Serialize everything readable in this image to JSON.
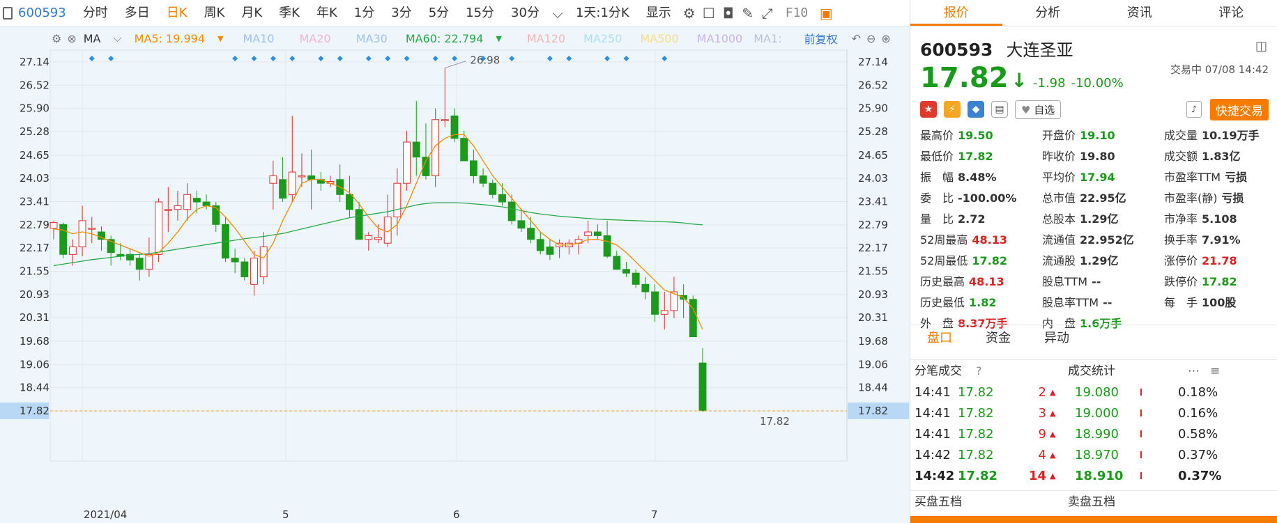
{
  "toolbar": {
    "code": "600593",
    "tabs": [
      "分时",
      "多日",
      "日K",
      "周K",
      "月K",
      "季K",
      "年K",
      "1分",
      "3分",
      "5分",
      "15分",
      "30分"
    ],
    "period": "1天:1分K",
    "display": "显示",
    "f10": "F10"
  },
  "ma_row": {
    "ma": "MA",
    "ma5": "MA5: 19.994",
    "ma10": "MA10",
    "ma20": "MA20",
    "ma30": "MA30",
    "ma60": "MA60: 22.794",
    "ma120": "MA120",
    "ma250": "MA250",
    "ma500": "MA500",
    "ma1000": "MA1000",
    "ma1": "MA1:",
    "adjust": "前复权",
    "colors": {
      "ma5": "#f08c00",
      "ma60": "#2aa84a",
      "faded_ma10": "#9ec2ea",
      "faded_ma20": "#f2b3cf",
      "faded_ma120": "#f5b5b5",
      "faded_ma250": "#aee0f0",
      "faded_ma500": "#f6dc8c",
      "faded_ma1000": "#c9b3ea",
      "faded_ma1": "#b9c5d2",
      "ma_label": "#333333",
      "adjust": "#3478d1"
    }
  },
  "chart_data": {
    "type": "candlestick",
    "y_ticks": [
      "27.14",
      "26.52",
      "25.90",
      "25.28",
      "24.65",
      "24.03",
      "23.41",
      "22.79",
      "22.17",
      "21.55",
      "20.93",
      "20.31",
      "19.68",
      "19.06",
      "18.44",
      "17.82"
    ],
    "ylim": [
      17.82,
      27.14
    ],
    "x_labels": [
      "2021/04",
      "5",
      "6",
      "7"
    ],
    "high_annotation": "26.98",
    "low_annotation": "17.82",
    "current_price_label": "17.82",
    "candles": [
      {
        "o": 22.7,
        "h": 22.9,
        "l": 22.4,
        "c": 22.85
      },
      {
        "o": 22.8,
        "h": 22.85,
        "l": 21.9,
        "c": 22.0
      },
      {
        "o": 22.0,
        "h": 22.4,
        "l": 21.7,
        "c": 22.2
      },
      {
        "o": 22.2,
        "h": 23.3,
        "l": 21.95,
        "c": 22.9
      },
      {
        "o": 22.7,
        "h": 23.0,
        "l": 22.3,
        "c": 22.7
      },
      {
        "o": 22.6,
        "h": 22.75,
        "l": 22.1,
        "c": 22.4
      },
      {
        "o": 22.4,
        "h": 22.5,
        "l": 21.7,
        "c": 22.05
      },
      {
        "o": 22.0,
        "h": 22.3,
        "l": 21.85,
        "c": 21.95
      },
      {
        "o": 22.0,
        "h": 22.15,
        "l": 21.7,
        "c": 21.85
      },
      {
        "o": 21.9,
        "h": 22.0,
        "l": 21.3,
        "c": 21.6
      },
      {
        "o": 21.6,
        "h": 22.45,
        "l": 21.4,
        "c": 22.0
      },
      {
        "o": 22.0,
        "h": 23.5,
        "l": 21.8,
        "c": 23.4
      },
      {
        "o": 23.2,
        "h": 23.8,
        "l": 22.6,
        "c": 23.2
      },
      {
        "o": 23.2,
        "h": 23.7,
        "l": 22.9,
        "c": 23.3
      },
      {
        "o": 23.2,
        "h": 23.9,
        "l": 22.9,
        "c": 23.6
      },
      {
        "o": 23.5,
        "h": 23.7,
        "l": 23.1,
        "c": 23.4
      },
      {
        "o": 23.4,
        "h": 23.6,
        "l": 23.2,
        "c": 23.3
      },
      {
        "o": 23.3,
        "h": 23.4,
        "l": 22.6,
        "c": 22.8
      },
      {
        "o": 22.8,
        "h": 23.0,
        "l": 21.8,
        "c": 21.9
      },
      {
        "o": 21.9,
        "h": 22.15,
        "l": 21.5,
        "c": 21.8
      },
      {
        "o": 21.8,
        "h": 21.9,
        "l": 21.3,
        "c": 21.4
      },
      {
        "o": 21.2,
        "h": 22.1,
        "l": 20.9,
        "c": 21.9
      },
      {
        "o": 21.4,
        "h": 22.6,
        "l": 21.2,
        "c": 22.2
      },
      {
        "o": 23.9,
        "h": 24.5,
        "l": 23.2,
        "c": 24.1
      },
      {
        "o": 24.0,
        "h": 24.6,
        "l": 23.4,
        "c": 23.5
      },
      {
        "o": 23.6,
        "h": 25.7,
        "l": 23.4,
        "c": 24.2
      },
      {
        "o": 24.1,
        "h": 24.7,
        "l": 23.8,
        "c": 24.1
      },
      {
        "o": 24.1,
        "h": 24.8,
        "l": 23.2,
        "c": 24.0
      },
      {
        "o": 24.0,
        "h": 24.2,
        "l": 23.7,
        "c": 23.9
      },
      {
        "o": 23.9,
        "h": 24.1,
        "l": 23.8,
        "c": 23.95
      },
      {
        "o": 24.0,
        "h": 24.4,
        "l": 23.4,
        "c": 23.6
      },
      {
        "o": 23.6,
        "h": 24.1,
        "l": 23.0,
        "c": 23.2
      },
      {
        "o": 23.2,
        "h": 23.4,
        "l": 22.4,
        "c": 22.4
      },
      {
        "o": 22.4,
        "h": 22.6,
        "l": 22.1,
        "c": 22.5
      },
      {
        "o": 22.4,
        "h": 22.8,
        "l": 22.3,
        "c": 22.45
      },
      {
        "o": 22.3,
        "h": 23.6,
        "l": 22.2,
        "c": 23.0
      },
      {
        "o": 23.0,
        "h": 24.3,
        "l": 22.5,
        "c": 23.9
      },
      {
        "o": 23.9,
        "h": 25.3,
        "l": 23.7,
        "c": 25.0
      },
      {
        "o": 25.0,
        "h": 26.1,
        "l": 24.1,
        "c": 24.6
      },
      {
        "o": 24.6,
        "h": 25.5,
        "l": 24.0,
        "c": 24.1
      },
      {
        "o": 24.1,
        "h": 25.9,
        "l": 23.8,
        "c": 25.6
      },
      {
        "o": 25.6,
        "h": 26.98,
        "l": 25.4,
        "c": 25.6
      },
      {
        "o": 25.7,
        "h": 25.9,
        "l": 25.0,
        "c": 25.1
      },
      {
        "o": 25.1,
        "h": 25.3,
        "l": 24.5,
        "c": 24.5
      },
      {
        "o": 24.5,
        "h": 24.8,
        "l": 23.9,
        "c": 24.1
      },
      {
        "o": 24.1,
        "h": 24.3,
        "l": 23.8,
        "c": 23.9
      },
      {
        "o": 23.9,
        "h": 24.0,
        "l": 23.5,
        "c": 23.6
      },
      {
        "o": 23.6,
        "h": 23.9,
        "l": 23.3,
        "c": 23.4
      },
      {
        "o": 23.4,
        "h": 23.6,
        "l": 22.8,
        "c": 22.9
      },
      {
        "o": 22.9,
        "h": 23.2,
        "l": 22.6,
        "c": 22.7
      },
      {
        "o": 22.7,
        "h": 23.0,
        "l": 22.3,
        "c": 22.4
      },
      {
        "o": 22.4,
        "h": 22.6,
        "l": 22.0,
        "c": 22.1
      },
      {
        "o": 22.2,
        "h": 22.4,
        "l": 21.85,
        "c": 22.0
      },
      {
        "o": 22.2,
        "h": 22.4,
        "l": 21.9,
        "c": 22.3
      },
      {
        "o": 22.2,
        "h": 22.4,
        "l": 22.0,
        "c": 22.3
      },
      {
        "o": 22.3,
        "h": 22.5,
        "l": 22.0,
        "c": 22.4
      },
      {
        "o": 22.5,
        "h": 22.9,
        "l": 22.3,
        "c": 22.6
      },
      {
        "o": 22.6,
        "h": 22.8,
        "l": 22.4,
        "c": 22.5
      },
      {
        "o": 22.5,
        "h": 22.9,
        "l": 21.9,
        "c": 21.95
      },
      {
        "o": 21.95,
        "h": 22.1,
        "l": 21.6,
        "c": 21.6
      },
      {
        "o": 21.6,
        "h": 21.8,
        "l": 21.4,
        "c": 21.5
      },
      {
        "o": 21.5,
        "h": 21.6,
        "l": 21.1,
        "c": 21.2
      },
      {
        "o": 21.2,
        "h": 21.4,
        "l": 20.8,
        "c": 21.0
      },
      {
        "o": 21.0,
        "h": 21.2,
        "l": 20.2,
        "c": 20.4
      },
      {
        "o": 20.4,
        "h": 21.0,
        "l": 20.0,
        "c": 20.5
      },
      {
        "o": 20.5,
        "h": 21.4,
        "l": 20.3,
        "c": 21.0
      },
      {
        "o": 20.9,
        "h": 21.2,
        "l": 20.3,
        "c": 20.8
      },
      {
        "o": 20.8,
        "h": 20.9,
        "l": 19.8,
        "c": 19.8
      },
      {
        "o": 19.1,
        "h": 19.5,
        "l": 17.82,
        "c": 17.82
      }
    ],
    "ma5": [
      22.68,
      22.65,
      22.55,
      22.6,
      22.55,
      22.45,
      22.35,
      22.25,
      22.15,
      22.05,
      21.95,
      22.05,
      22.3,
      22.6,
      22.95,
      23.2,
      23.3,
      23.25,
      23.0,
      22.7,
      22.35,
      22.0,
      21.9,
      22.3,
      22.9,
      23.4,
      23.9,
      24.0,
      24.0,
      23.9,
      23.8,
      23.65,
      23.35,
      23.0,
      22.7,
      22.6,
      22.8,
      23.3,
      23.9,
      24.5,
      24.9,
      25.1,
      25.2,
      25.2,
      24.9,
      24.5,
      24.1,
      23.8,
      23.5,
      23.2,
      22.9,
      22.6,
      22.4,
      22.25,
      22.25,
      22.3,
      22.4,
      22.4,
      22.35,
      22.25,
      22.05,
      21.8,
      21.55,
      21.3,
      21.05,
      20.95,
      20.85,
      20.55,
      20.0
    ],
    "ma60": [
      21.7,
      21.74,
      21.78,
      21.82,
      21.86,
      21.89,
      21.92,
      21.95,
      21.98,
      22.0,
      22.02,
      22.06,
      22.1,
      22.14,
      22.18,
      22.22,
      22.26,
      22.3,
      22.34,
      22.38,
      22.42,
      22.45,
      22.48,
      22.52,
      22.56,
      22.62,
      22.68,
      22.74,
      22.8,
      22.86,
      22.92,
      22.98,
      23.02,
      23.06,
      23.1,
      23.14,
      23.2,
      23.26,
      23.32,
      23.36,
      23.38,
      23.38,
      23.38,
      23.37,
      23.35,
      23.33,
      23.3,
      23.27,
      23.22,
      23.17,
      23.12,
      23.08,
      23.05,
      23.02,
      23.0,
      22.98,
      22.96,
      22.94,
      22.93,
      22.92,
      22.91,
      22.9,
      22.89,
      22.88,
      22.87,
      22.86,
      22.84,
      22.81,
      22.79
    ],
    "marker_indices": [
      4,
      6,
      19,
      21,
      23,
      25,
      28,
      30,
      33,
      35,
      37,
      40,
      42,
      45,
      48,
      52,
      54,
      58,
      60,
      64
    ]
  },
  "right_panel": {
    "tabs": [
      "报价",
      "分析",
      "资讯",
      "评论"
    ],
    "code": "600593",
    "name": "大连圣亚",
    "price": "17.82",
    "change": "-1.98",
    "change_pct": "-10.00%",
    "status": "交易中 07/08 14:42",
    "fav": "自选",
    "quick_trade": "快捷交易",
    "quotes": [
      {
        "k": "最高价",
        "v": "19.50",
        "c": "green"
      },
      {
        "k": "开盘价",
        "v": "19.10",
        "c": "green"
      },
      {
        "k": "成交量",
        "v": "10.19万手",
        "c": ""
      },
      {
        "k": "最低价",
        "v": "17.82",
        "c": "green"
      },
      {
        "k": "昨收价",
        "v": "19.80",
        "c": ""
      },
      {
        "k": "成交额",
        "v": "1.83亿",
        "c": ""
      },
      {
        "k": "振　幅",
        "v": "8.48%",
        "c": ""
      },
      {
        "k": "平均价",
        "v": "17.94",
        "c": "green"
      },
      {
        "k": "市盈率TTM",
        "v": "亏损",
        "c": ""
      },
      {
        "k": "委　比",
        "v": "-100.00%",
        "c": ""
      },
      {
        "k": "总市值",
        "v": "22.95亿",
        "c": ""
      },
      {
        "k": "市盈率(静)",
        "v": "亏损",
        "c": ""
      },
      {
        "k": "量　比",
        "v": "2.72",
        "c": ""
      },
      {
        "k": "总股本",
        "v": "1.29亿",
        "c": ""
      },
      {
        "k": "市净率",
        "v": "5.108",
        "c": ""
      },
      {
        "k": "52周最高",
        "v": "48.13",
        "c": "red"
      },
      {
        "k": "流通值",
        "v": "22.952亿",
        "c": ""
      },
      {
        "k": "换手率",
        "v": "7.91%",
        "c": ""
      },
      {
        "k": "52周最低",
        "v": "17.82",
        "c": "green"
      },
      {
        "k": "流通股",
        "v": "1.29亿",
        "c": ""
      },
      {
        "k": "涨停价",
        "v": "21.78",
        "c": "red"
      },
      {
        "k": "历史最高",
        "v": "48.13",
        "c": "red"
      },
      {
        "k": "股息TTM",
        "v": "--",
        "c": ""
      },
      {
        "k": "跌停价",
        "v": "17.82",
        "c": "green"
      },
      {
        "k": "历史最低",
        "v": "1.82",
        "c": "green"
      },
      {
        "k": "股息率TTM",
        "v": "--",
        "c": ""
      },
      {
        "k": "每　手",
        "v": "100股",
        "c": ""
      },
      {
        "k": "外　盘",
        "v": "8.37万手",
        "c": "red"
      },
      {
        "k": "内　盘",
        "v": "1.6万手",
        "c": "green"
      }
    ],
    "subtabs": [
      "盘口",
      "资金",
      "异动"
    ],
    "trades_title": "分笔成交",
    "stats_title": "成交统计",
    "trades": [
      {
        "t": "14:41",
        "p": "17.82",
        "v": "2",
        "sp": "19.080",
        "pct": "0.18%"
      },
      {
        "t": "14:41",
        "p": "17.82",
        "v": "3",
        "sp": "19.000",
        "pct": "0.16%"
      },
      {
        "t": "14:41",
        "p": "17.82",
        "v": "9",
        "sp": "18.990",
        "pct": "0.58%"
      },
      {
        "t": "14:42",
        "p": "17.82",
        "v": "4",
        "sp": "18.970",
        "pct": "0.37%"
      },
      {
        "t": "14:42",
        "p": "17.82",
        "v": "14",
        "sp": "18.910",
        "pct": "0.37%"
      }
    ],
    "bid_title": "买盘五档",
    "ask_title": "卖盘五档"
  }
}
